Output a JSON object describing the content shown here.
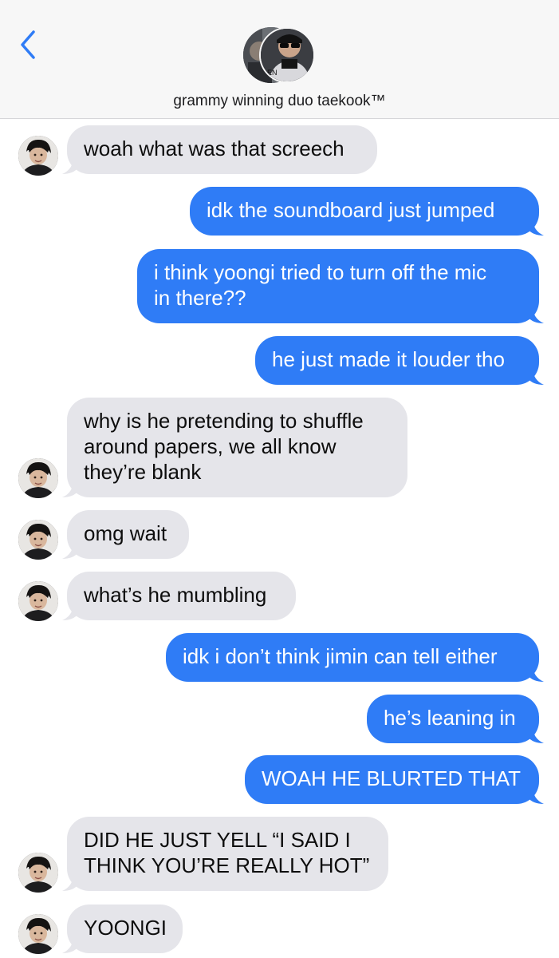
{
  "header": {
    "contact_name": "grammy winning duo taekook™",
    "accent": "#2f7cf6"
  },
  "messages": [
    {
      "dir": "in",
      "text": "woah what was that screech"
    },
    {
      "dir": "out",
      "text": "idk the soundboard just jumped"
    },
    {
      "dir": "out",
      "text": "i think yoongi tried to turn off the mic\nin there??"
    },
    {
      "dir": "out",
      "text": "he just made it louder tho"
    },
    {
      "dir": "in",
      "text": "why is he pretending to shuffle\naround papers, we all know\nthey’re blank"
    },
    {
      "dir": "in",
      "text": "omg wait"
    },
    {
      "dir": "in",
      "text": "what’s he mumbling"
    },
    {
      "dir": "out",
      "text": "idk i don’t think jimin can tell either"
    },
    {
      "dir": "out",
      "text": "he’s leaning in"
    },
    {
      "dir": "out",
      "text": "WOAH HE BLURTED THAT"
    },
    {
      "dir": "in",
      "text": "DID HE JUST YELL “I SAID I\nTHINK YOU’RE REALLY HOT”"
    },
    {
      "dir": "in",
      "text": "YOONGI"
    }
  ]
}
